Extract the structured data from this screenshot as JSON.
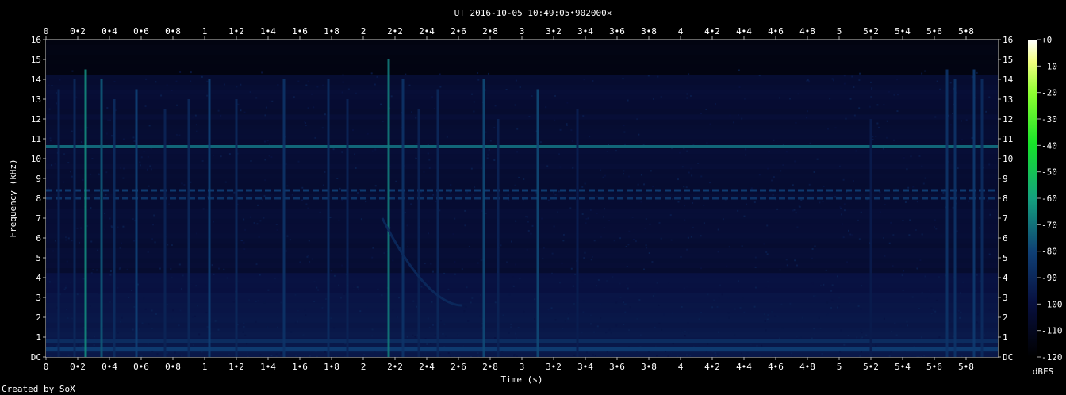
{
  "title": "UT 2016-10-05 10:49:05•902000×",
  "credit": "Created by SoX",
  "chart_data": {
    "type": "heatmap",
    "title": "UT 2016-10-05 10:49:05•902000×",
    "xlabel": "Time (s)",
    "ylabel": "Frequency (kHz)",
    "xlim": [
      0,
      5.95
    ],
    "ylim": [
      0,
      16
    ],
    "x_ticks": [
      0,
      0.2,
      0.4,
      0.6,
      0.8,
      1,
      1.2,
      1.4,
      1.6,
      1.8,
      2,
      2.2,
      2.4,
      2.6,
      2.8,
      3,
      3.2,
      3.4,
      3.6,
      3.8,
      4,
      4.2,
      4.4,
      4.6,
      4.8,
      5,
      5.2,
      5.4,
      5.6,
      5.8
    ],
    "x_tick_labels": [
      "0",
      "0•2",
      "0•4",
      "0•6",
      "0•8",
      "1",
      "1•2",
      "1•4",
      "1•6",
      "1•8",
      "2",
      "2•2",
      "2•4",
      "2•6",
      "2•8",
      "3",
      "3•2",
      "3•4",
      "3•6",
      "3•8",
      "4",
      "4•2",
      "4•4",
      "4•6",
      "4•8",
      "5",
      "5•2",
      "5•4",
      "5•6",
      "5•8"
    ],
    "y_ticks": [
      0,
      1,
      2,
      3,
      4,
      5,
      6,
      7,
      8,
      9,
      10,
      11,
      12,
      13,
      14,
      15,
      16
    ],
    "y_tick_labels": [
      "DC",
      "1",
      "2",
      "3",
      "4",
      "5",
      "6",
      "7",
      "8",
      "9",
      "10",
      "11",
      "12",
      "13",
      "14",
      "15",
      "16"
    ],
    "colorbar": {
      "label": "dBFS",
      "range": [
        -120,
        0
      ],
      "ticks": [
        0,
        -10,
        -20,
        -30,
        -40,
        -50,
        -60,
        -70,
        -80,
        -90,
        -100,
        -110,
        -120
      ],
      "tick_labels": [
        "+0",
        "-10",
        "-20",
        "-30",
        "-40",
        "-50",
        "-60",
        "-70",
        "-80",
        "-90",
        "-100",
        "-110",
        "-120"
      ]
    },
    "background_level_dbfs": -105,
    "horizontal_tones": [
      {
        "freq_khz": 10.6,
        "level_dbfs": -72,
        "pattern": "continuous"
      },
      {
        "freq_khz": 8.4,
        "level_dbfs": -82,
        "pattern": "dashed"
      },
      {
        "freq_khz": 8.0,
        "level_dbfs": -85,
        "pattern": "dashed"
      },
      {
        "freq_khz": 0.4,
        "level_dbfs": -82,
        "pattern": "continuous"
      },
      {
        "freq_khz": 0.8,
        "level_dbfs": -88,
        "pattern": "continuous"
      }
    ],
    "vertical_impulses": [
      {
        "t": 0.08,
        "fmax": 13.5,
        "level_dbfs": -92
      },
      {
        "t": 0.18,
        "fmax": 14,
        "level_dbfs": -90
      },
      {
        "t": 0.25,
        "fmax": 14.5,
        "level_dbfs": -65
      },
      {
        "t": 0.35,
        "fmax": 14,
        "level_dbfs": -75
      },
      {
        "t": 0.43,
        "fmax": 13,
        "level_dbfs": -88
      },
      {
        "t": 0.57,
        "fmax": 13.5,
        "level_dbfs": -80
      },
      {
        "t": 0.75,
        "fmax": 12.5,
        "level_dbfs": -92
      },
      {
        "t": 0.9,
        "fmax": 13,
        "level_dbfs": -90
      },
      {
        "t": 1.03,
        "fmax": 14,
        "level_dbfs": -80
      },
      {
        "t": 1.2,
        "fmax": 13,
        "level_dbfs": -90
      },
      {
        "t": 1.5,
        "fmax": 14,
        "level_dbfs": -85
      },
      {
        "t": 1.78,
        "fmax": 14,
        "level_dbfs": -88
      },
      {
        "t": 1.9,
        "fmax": 13,
        "level_dbfs": -92
      },
      {
        "t": 2.16,
        "fmax": 15,
        "level_dbfs": -68
      },
      {
        "t": 2.25,
        "fmax": 14,
        "level_dbfs": -85
      },
      {
        "t": 2.35,
        "fmax": 12.5,
        "level_dbfs": -92
      },
      {
        "t": 2.47,
        "fmax": 13.5,
        "level_dbfs": -90
      },
      {
        "t": 2.76,
        "fmax": 14,
        "level_dbfs": -78
      },
      {
        "t": 2.85,
        "fmax": 12,
        "level_dbfs": -92
      },
      {
        "t": 3.1,
        "fmax": 13.5,
        "level_dbfs": -78
      },
      {
        "t": 3.35,
        "fmax": 12.5,
        "level_dbfs": -94
      },
      {
        "t": 5.2,
        "fmax": 12,
        "level_dbfs": -95
      },
      {
        "t": 5.68,
        "fmax": 14.5,
        "level_dbfs": -85
      },
      {
        "t": 5.73,
        "fmax": 14,
        "level_dbfs": -85
      },
      {
        "t": 5.85,
        "fmax": 14.5,
        "level_dbfs": -82
      },
      {
        "t": 5.9,
        "fmax": 14,
        "level_dbfs": -88
      }
    ],
    "chirp": {
      "t_start": 2.12,
      "f_start_khz": 7.0,
      "t_end": 2.62,
      "f_end_khz": 2.6,
      "level_dbfs": -88
    }
  }
}
